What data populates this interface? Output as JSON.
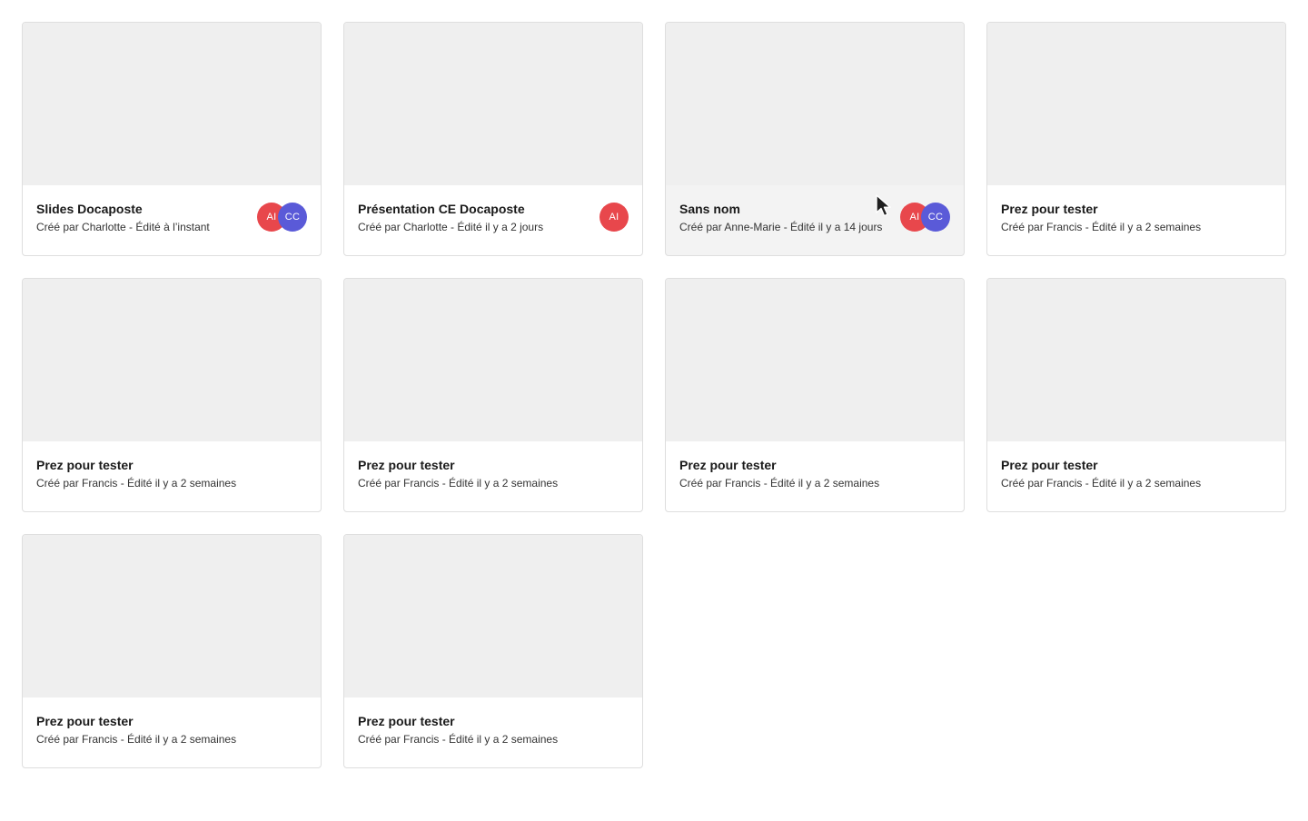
{
  "colors": {
    "avatar_ai": "#e8474c",
    "avatar_cc": "#5a5ad8"
  },
  "cards": [
    {
      "title": "Slides Docaposte",
      "meta": "Créé par Charlotte - Édité à l’instant",
      "avatars": [
        {
          "initials": "AI",
          "color": "#e8474c"
        },
        {
          "initials": "CC",
          "color": "#5a5ad8"
        }
      ]
    },
    {
      "title": "Présentation CE Docaposte",
      "meta": "Créé par Charlotte - Édité il y a 2 jours",
      "avatars": [
        {
          "initials": "AI",
          "color": "#e8474c"
        }
      ]
    },
    {
      "title": "Sans nom",
      "meta": "Créé par Anne-Marie - Édité il y a 14 jours",
      "hovered": true,
      "avatars": [
        {
          "initials": "AI",
          "color": "#e8474c"
        },
        {
          "initials": "CC",
          "color": "#5a5ad8"
        }
      ]
    },
    {
      "title": "Prez pour tester",
      "meta": "Créé par Francis - Édité il y a 2 semaines",
      "avatars": []
    },
    {
      "title": "Prez pour tester",
      "meta": "Créé par Francis - Édité il y a 2 semaines",
      "avatars": []
    },
    {
      "title": "Prez pour tester",
      "meta": "Créé par Francis - Édité il y a 2 semaines",
      "avatars": []
    },
    {
      "title": "Prez pour tester",
      "meta": "Créé par Francis - Édité il y a 2 semaines",
      "avatars": []
    },
    {
      "title": "Prez pour tester",
      "meta": "Créé par Francis - Édité il y a 2 semaines",
      "avatars": []
    },
    {
      "title": "Prez pour tester",
      "meta": "Créé par Francis - Édité il y a 2 semaines",
      "avatars": []
    },
    {
      "title": "Prez pour tester",
      "meta": "Créé par Francis - Édité il y a 2 semaines",
      "avatars": []
    }
  ],
  "cursor_icon": "mouse-pointer-icon"
}
